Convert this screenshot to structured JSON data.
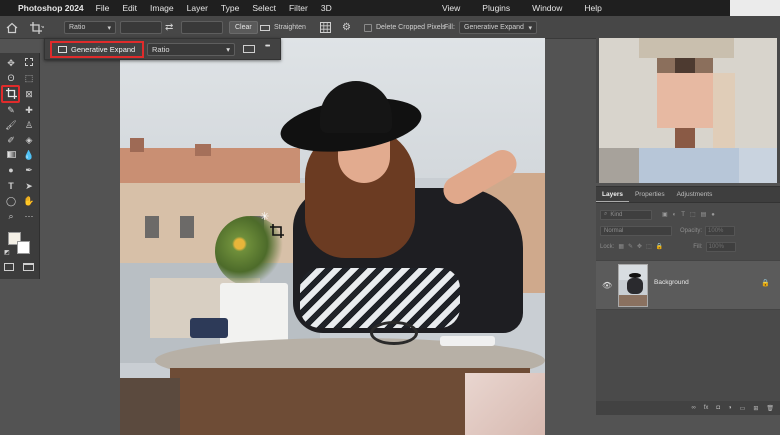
{
  "menubar": {
    "app": "Photoshop 2024",
    "items": [
      "File",
      "Edit",
      "Image",
      "Layer",
      "Type",
      "Select",
      "Filter",
      "3D"
    ],
    "right_items": [
      "View",
      "Plugins",
      "Window",
      "Help"
    ]
  },
  "options_bar": {
    "ratio_select": "Ratio",
    "clear_label": "Clear",
    "straighten_label": "Straighten",
    "delete_cropped_label": "Delete Cropped Pixels",
    "fill_label": "Fill:",
    "fill_value": "Generative Expand"
  },
  "gen_bar": {
    "button_label": "Generative Expand",
    "ratio_select": "Ratio",
    "more_label": "•••"
  },
  "panel": {
    "tabs": [
      "Layers",
      "Properties",
      "Adjustments"
    ],
    "filter_placeholder": "Kind",
    "blend_mode": "Normal",
    "opacity_label": "Opacity:",
    "opacity_value": "100%",
    "lock_label": "Lock:",
    "fill_label": "Fill:",
    "fill_value": "100%",
    "layer_name": "Background"
  },
  "colors": {
    "highlight": "#e02b2b",
    "ui_dark": "#3c3c3c",
    "workspace": "#535353"
  }
}
